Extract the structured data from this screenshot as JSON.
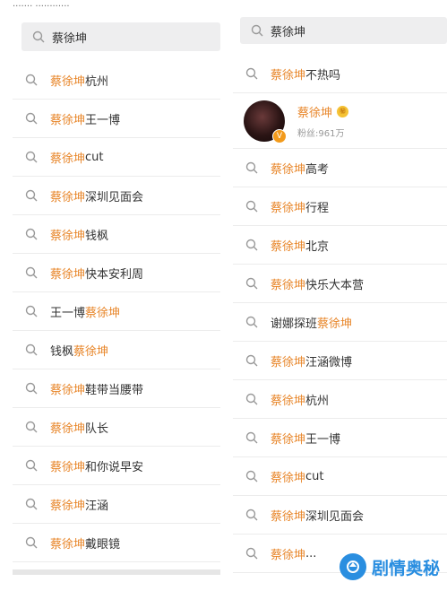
{
  "left": {
    "status_text": "....... ............",
    "search_value": "蔡徐坤",
    "items": [
      {
        "hl": "蔡徐坤",
        "rest": "杭州"
      },
      {
        "hl": "蔡徐坤",
        "rest": "王一博"
      },
      {
        "hl": "蔡徐坤",
        "rest": "cut"
      },
      {
        "hl": "蔡徐坤",
        "rest": "深圳见面会"
      },
      {
        "hl": "蔡徐坤",
        "rest": "钱枫"
      },
      {
        "hl": "蔡徐坤",
        "rest": "快本安利周"
      },
      {
        "pre": "王一博",
        "hl": "蔡徐坤"
      },
      {
        "pre": "钱枫",
        "hl": "蔡徐坤"
      },
      {
        "hl": "蔡徐坤",
        "rest": " 鞋带当腰带"
      },
      {
        "hl": "蔡徐坤",
        "rest": "队长"
      },
      {
        "hl": "蔡徐坤",
        "rest": "和你说早安"
      },
      {
        "hl": "蔡徐坤",
        "rest": "汪涵"
      },
      {
        "hl": "蔡徐坤",
        "rest": "戴眼镜"
      }
    ]
  },
  "right": {
    "search_value": "蔡徐坤",
    "first_item": {
      "hl": "蔡徐坤",
      "rest": "不热吗"
    },
    "user": {
      "name": "蔡徐坤",
      "fans": "粉丝:961万",
      "badge": "V",
      "vip": "㊙"
    },
    "items": [
      {
        "hl": "蔡徐坤",
        "rest": "高考"
      },
      {
        "hl": "蔡徐坤",
        "rest": "行程"
      },
      {
        "hl": "蔡徐坤",
        "rest": "北京"
      },
      {
        "hl": "蔡徐坤",
        "rest": " 快乐大本营"
      },
      {
        "pre": "谢娜探班",
        "hl": "蔡徐坤"
      },
      {
        "hl": "蔡徐坤",
        "rest": " 汪涵微博"
      },
      {
        "hl": "蔡徐坤",
        "rest": "杭州"
      },
      {
        "hl": "蔡徐坤",
        "rest": "王一博"
      },
      {
        "hl": "蔡徐坤",
        "rest": "cut"
      },
      {
        "hl": "蔡徐坤",
        "rest": "深圳见面会"
      },
      {
        "hl": "蔡徐坤",
        "rest": "..."
      }
    ]
  },
  "watermark": {
    "text": "剧情奥秘"
  },
  "icons": {
    "search": "search-icon",
    "logo": "watermark-logo-icon"
  },
  "colors": {
    "highlight": "#e8862a",
    "watermark": "#2a8ee0"
  }
}
